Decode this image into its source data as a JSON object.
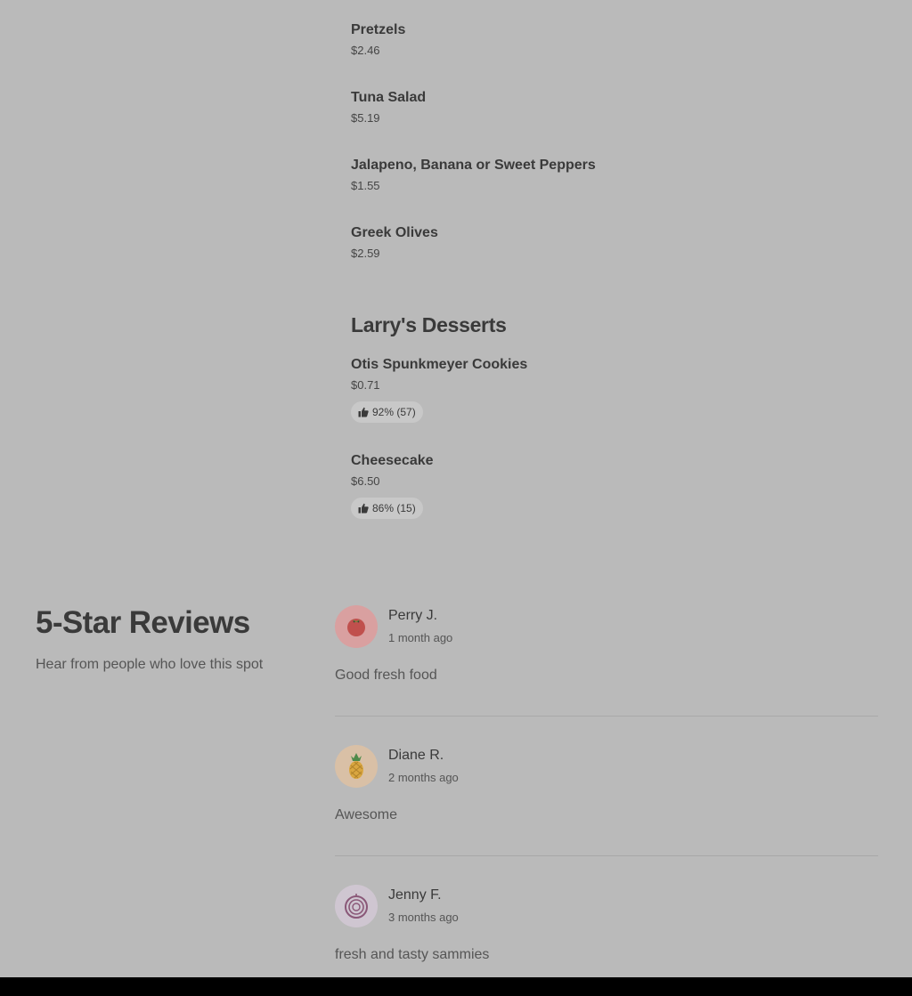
{
  "menu": {
    "items_top": [
      {
        "name": "Pretzels",
        "price": "$2.46"
      },
      {
        "name": "Tuna Salad",
        "price": "$5.19"
      },
      {
        "name": "Jalapeno, Banana or Sweet Peppers",
        "price": "$1.55"
      },
      {
        "name": "Greek Olives",
        "price": "$2.59"
      }
    ],
    "desserts": {
      "title": "Larry's Desserts",
      "items": [
        {
          "name": "Otis Spunkmeyer Cookies",
          "price": "$0.71",
          "rating": "92% (57)"
        },
        {
          "name": "Cheesecake",
          "price": "$6.50",
          "rating": "86% (15)"
        }
      ]
    }
  },
  "reviews": {
    "heading": "5-Star Reviews",
    "subheading": "Hear from people who love this spot",
    "items": [
      {
        "name": "Perry J.",
        "date": "1 month ago",
        "text": "Good fresh food",
        "avatar_icon": "tomato-icon",
        "avatar_bg": "#d9a0a0"
      },
      {
        "name": "Diane R.",
        "date": "2 months ago",
        "text": "Awesome",
        "avatar_icon": "pineapple-icon",
        "avatar_bg": "#d9c0a6"
      },
      {
        "name": "Jenny F.",
        "date": "3 months ago",
        "text": "fresh and tasty sammies",
        "avatar_icon": "onion-icon",
        "avatar_bg": "#cfc6d1"
      }
    ]
  }
}
